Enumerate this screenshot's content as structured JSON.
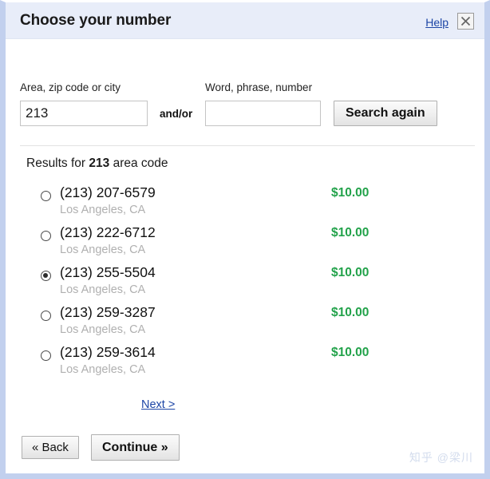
{
  "dialog": {
    "title": "Choose your number",
    "help_label": "Help",
    "close_icon": "close-icon"
  },
  "search": {
    "area_label": "Area, zip code or city",
    "word_label": "Word, phrase, number",
    "area_value": "213",
    "area_placeholder": "",
    "word_value": "",
    "word_placeholder": "",
    "andor_label": "and/or",
    "search_button": "Search again"
  },
  "results": {
    "heading_prefix": "Results for ",
    "heading_query": "213",
    "heading_suffix": " area code",
    "next_label": "Next >",
    "items": [
      {
        "number": "(213) 207-6579",
        "location": "Los Angeles, CA",
        "price": "$10.00",
        "selected": false
      },
      {
        "number": "(213) 222-6712",
        "location": "Los Angeles, CA",
        "price": "$10.00",
        "selected": false
      },
      {
        "number": "(213) 255-5504",
        "location": "Los Angeles, CA",
        "price": "$10.00",
        "selected": true
      },
      {
        "number": "(213) 259-3287",
        "location": "Los Angeles, CA",
        "price": "$10.00",
        "selected": false
      },
      {
        "number": "(213) 259-3614",
        "location": "Los Angeles, CA",
        "price": "$10.00",
        "selected": false
      }
    ]
  },
  "footer": {
    "back_label": "« Back",
    "continue_label": "Continue »"
  },
  "watermark": {
    "text": "知乎 @梁川"
  },
  "colors": {
    "header_bg": "#e8edf9",
    "frame": "#c2d0ee",
    "link": "#1d46a6",
    "price_green": "#22a24a",
    "location_gray": "#b0b0b0"
  }
}
